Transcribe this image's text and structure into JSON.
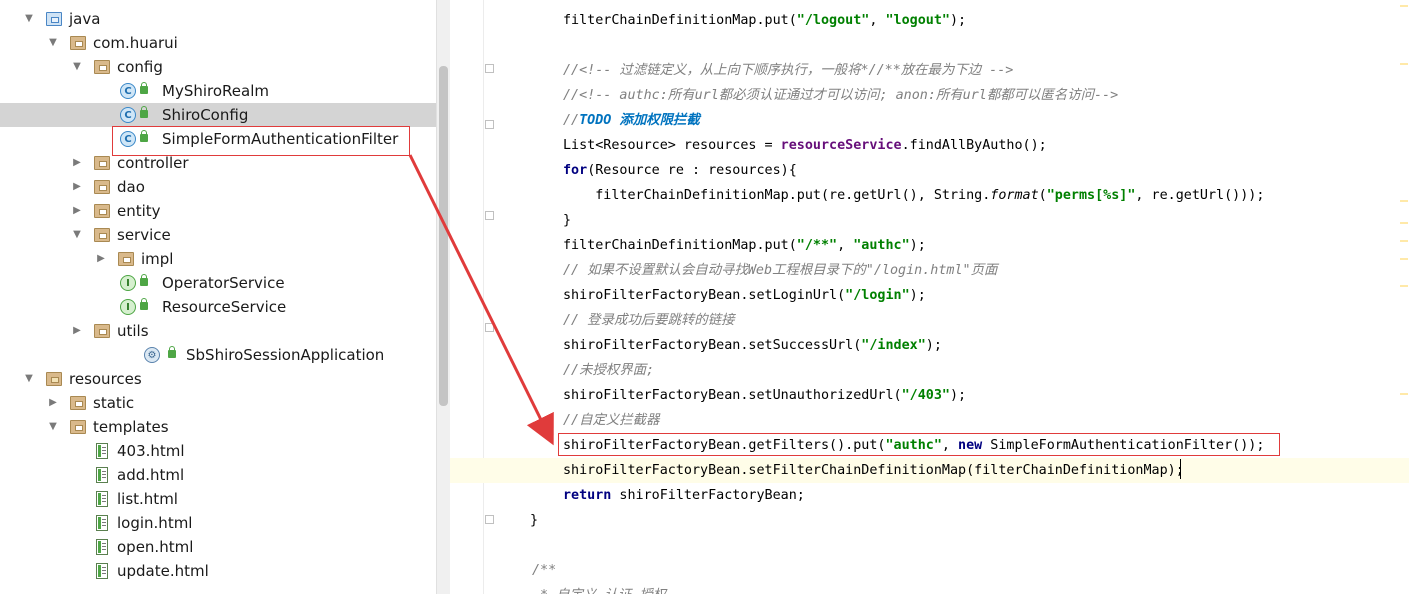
{
  "tree": {
    "items": [
      {
        "label": "java",
        "icon": "source-folder-icon",
        "expanded": true,
        "depth": 1
      },
      {
        "label": "com.huarui",
        "icon": "package-icon",
        "expanded": true,
        "depth": 2
      },
      {
        "label": "config",
        "icon": "package-icon",
        "expanded": true,
        "depth": 3
      },
      {
        "label": "MyShiroRealm",
        "icon": "class-icon",
        "depth": 4
      },
      {
        "label": "ShiroConfig",
        "icon": "class-icon",
        "depth": 4,
        "selected": true
      },
      {
        "label": "SimpleFormAuthenticationFilter",
        "icon": "class-icon",
        "depth": 4
      },
      {
        "label": "controller",
        "icon": "package-icon",
        "expanded": false,
        "depth": 3
      },
      {
        "label": "dao",
        "icon": "package-icon",
        "expanded": false,
        "depth": 3
      },
      {
        "label": "entity",
        "icon": "package-icon",
        "expanded": false,
        "depth": 3
      },
      {
        "label": "service",
        "icon": "package-icon",
        "expanded": true,
        "depth": 3
      },
      {
        "label": "impl",
        "icon": "package-icon",
        "expanded": false,
        "depth": 4
      },
      {
        "label": "OperatorService",
        "icon": "interface-icon",
        "depth": 4
      },
      {
        "label": "ResourceService",
        "icon": "interface-icon",
        "depth": 4
      },
      {
        "label": "utils",
        "icon": "package-icon",
        "expanded": false,
        "depth": 3
      },
      {
        "label": "SbShiroSessionApplication",
        "icon": "spring-boot-class-icon",
        "depth": 3
      },
      {
        "label": "resources",
        "icon": "resources-folder-icon",
        "expanded": true,
        "depth": 1
      },
      {
        "label": "static",
        "icon": "folder-icon",
        "expanded": false,
        "depth": 2
      },
      {
        "label": "templates",
        "icon": "folder-icon",
        "expanded": true,
        "depth": 2
      },
      {
        "label": "403.html",
        "icon": "html-file-icon",
        "depth": 3
      },
      {
        "label": "add.html",
        "icon": "html-file-icon",
        "depth": 3
      },
      {
        "label": "list.html",
        "icon": "html-file-icon",
        "depth": 3
      },
      {
        "label": "login.html",
        "icon": "html-file-icon",
        "depth": 3
      },
      {
        "label": "open.html",
        "icon": "html-file-icon",
        "depth": 3
      },
      {
        "label": "update.html",
        "icon": "html-file-icon",
        "depth": 3
      }
    ]
  },
  "editor": {
    "lines": [
      [
        [
          "n",
          "filterChainDefinitionMap.put("
        ],
        [
          "s",
          "\"/logout\""
        ],
        [
          "n",
          ", "
        ],
        [
          "s",
          "\"logout\""
        ],
        [
          "n",
          ");"
        ]
      ],
      [],
      [
        [
          "c",
          "//<!-- 过滤链定义，从上向下顺序执行，一般将*//**放在最为下边 -->"
        ]
      ],
      [
        [
          "c",
          "//<!-- authc:所有url都必须认证通过才可以访问; anon:所有url都都可以匿名访问-->"
        ]
      ],
      [
        [
          "c",
          "//"
        ],
        [
          "t",
          "TODO 添加权限拦截"
        ]
      ],
      [
        [
          "n",
          "List<Resource> resources = "
        ],
        [
          "f",
          "resourceService"
        ],
        [
          "n",
          ".findAllByAutho();"
        ]
      ],
      [
        [
          "k",
          "for"
        ],
        [
          "n",
          "(Resource re : resources){"
        ]
      ],
      [
        [
          "n",
          "    filterChainDefinitionMap.put(re.getUrl(), String."
        ],
        [
          "i",
          "format"
        ],
        [
          "n",
          "("
        ],
        [
          "s",
          "\"perms[%s]\""
        ],
        [
          "n",
          ", re.getUrl()));"
        ]
      ],
      [
        [
          "n",
          "}"
        ]
      ],
      [
        [
          "n",
          "filterChainDefinitionMap.put("
        ],
        [
          "s",
          "\"/**\""
        ],
        [
          "n",
          ", "
        ],
        [
          "s",
          "\"authc\""
        ],
        [
          "n",
          ");"
        ]
      ],
      [
        [
          "c",
          "// 如果不设置默认会自动寻找Web工程根目录下的\"/login.html\"页面"
        ]
      ],
      [
        [
          "n",
          "shiroFilterFactoryBean.setLoginUrl("
        ],
        [
          "s",
          "\"/login\""
        ],
        [
          "n",
          ");"
        ]
      ],
      [
        [
          "c",
          "// 登录成功后要跳转的链接"
        ]
      ],
      [
        [
          "n",
          "shiroFilterFactoryBean.setSuccessUrl("
        ],
        [
          "s",
          "\"/index\""
        ],
        [
          "n",
          ");"
        ]
      ],
      [
        [
          "c",
          "//未授权界面;"
        ]
      ],
      [
        [
          "n",
          "shiroFilterFactoryBean.setUnauthorizedUrl("
        ],
        [
          "s",
          "\"/403\""
        ],
        [
          "n",
          ");"
        ]
      ],
      [
        [
          "c",
          "//自定义拦截器"
        ]
      ],
      [
        [
          "n",
          "shiroFilterFactoryBean.getFilters().put("
        ],
        [
          "s",
          "\"authc\""
        ],
        [
          "n",
          ", "
        ],
        [
          "k",
          "new"
        ],
        [
          "n",
          " SimpleFormAuthenticationFilter());"
        ]
      ],
      [
        [
          "n",
          "shiroFilterFactoryBean.setFilterChainDefinitionMap(filterChainDefinitionMap);"
        ]
      ],
      [
        [
          "k",
          "return"
        ],
        [
          "n",
          " shiroFilterFactoryBean;"
        ]
      ],
      [
        [
          "n",
          "}"
        ]
      ],
      [],
      [
        [
          "c",
          "/**"
        ]
      ],
      [
        [
          "c",
          " * 自定义 认证 授权"
        ]
      ]
    ]
  },
  "colors": {
    "keyword": "#000080",
    "string": "#008000",
    "field": "#660e7a",
    "comment": "#808080",
    "todo": "#0073bf",
    "annotation_red": "#e03b3b",
    "current_line": "#fffde8"
  }
}
